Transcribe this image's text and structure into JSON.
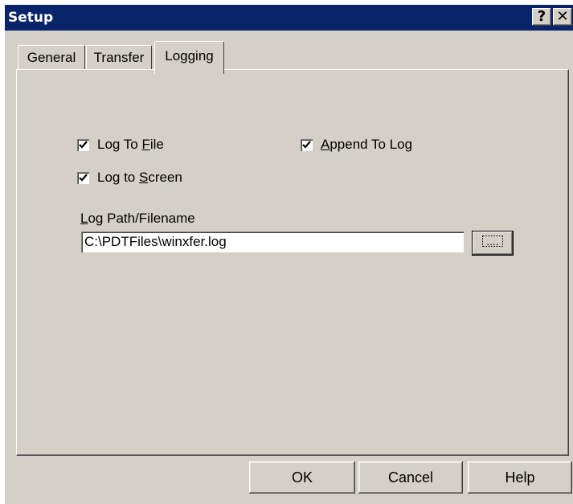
{
  "window": {
    "title": "Setup",
    "help_glyph": "?",
    "close_glyph": "✕"
  },
  "tabs": [
    {
      "label": "General",
      "active": false
    },
    {
      "label": "Transfer",
      "active": false
    },
    {
      "label": "Logging",
      "active": true
    }
  ],
  "logging": {
    "log_to_file": {
      "prefix": "Log To ",
      "mnemonic": "F",
      "suffix": "ile",
      "checked": true
    },
    "append_to_log": {
      "prefix": "",
      "mnemonic": "A",
      "suffix": "ppend To Log",
      "checked": true
    },
    "log_to_screen": {
      "prefix": "Log to ",
      "mnemonic": "S",
      "suffix": "creen",
      "checked": true
    },
    "path_label": {
      "prefix": "",
      "mnemonic": "L",
      "suffix": "og Path/Filename"
    },
    "path_value": "C:\\PDTFiles\\winxfer.log",
    "browse_label": "...."
  },
  "buttons": {
    "ok": "OK",
    "cancel": "Cancel",
    "help": "Help"
  }
}
